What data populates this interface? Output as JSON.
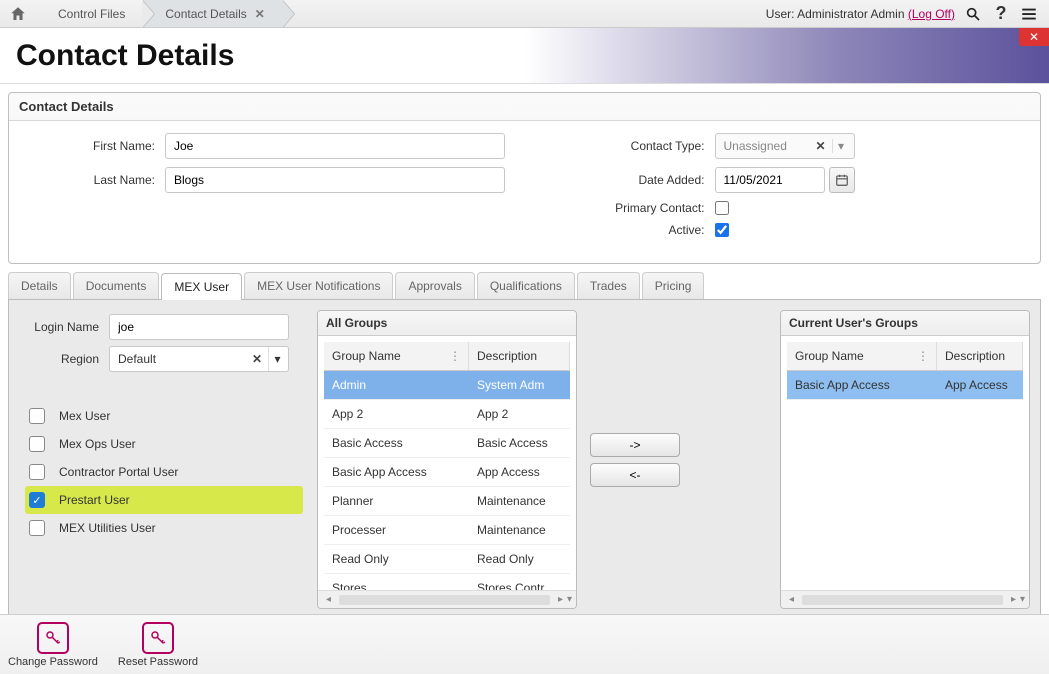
{
  "breadcrumb": {
    "item0": "Control Files",
    "item1": "Contact Details"
  },
  "userbar": {
    "prefix": "User: ",
    "name": "Administrator Admin",
    "logoff": "(Log Off)"
  },
  "page_title": "Contact Details",
  "panel": {
    "title": "Contact Details",
    "first_name_label": "First Name:",
    "first_name": "Joe",
    "last_name_label": "Last Name:",
    "last_name": "Blogs",
    "contact_type_label": "Contact Type:",
    "contact_type": "Unassigned",
    "date_added_label": "Date Added:",
    "date_added": "11/05/2021",
    "primary_label": "Primary Contact:",
    "active_label": "Active:"
  },
  "tabs": {
    "t0": "Details",
    "t1": "Documents",
    "t2": "MEX User",
    "t3": "MEX User Notifications",
    "t4": "Approvals",
    "t5": "Qualifications",
    "t6": "Trades",
    "t7": "Pricing"
  },
  "mex": {
    "login_label": "Login Name",
    "login": "joe",
    "region_label": "Region",
    "region": "Default",
    "checks": {
      "c0": "Mex User",
      "c1": "Mex Ops User",
      "c2": "Contractor Portal User",
      "c3": "Prestart User",
      "c4": "MEX Utilities User"
    }
  },
  "all_groups": {
    "title": "All Groups",
    "col_name": "Group Name",
    "col_desc": "Description",
    "rows": [
      {
        "name": "Admin",
        "desc": "System Adm"
      },
      {
        "name": "App 2",
        "desc": "App 2"
      },
      {
        "name": "Basic Access",
        "desc": "Basic Access"
      },
      {
        "name": "Basic App Access",
        "desc": "App Access"
      },
      {
        "name": "Planner",
        "desc": "Maintenance"
      },
      {
        "name": "Processer",
        "desc": "Maintenance"
      },
      {
        "name": "Read Only",
        "desc": "Read Only"
      },
      {
        "name": "Stores",
        "desc": "Stores Contr"
      }
    ]
  },
  "transfer": {
    "right": "->",
    "left": "<-"
  },
  "current_groups": {
    "title": "Current User's Groups",
    "col_name": "Group Name",
    "col_desc": "Description",
    "rows": [
      {
        "name": "Basic App Access",
        "desc": "App Access"
      }
    ]
  },
  "bottom": {
    "change": "Change Password",
    "reset": "Reset Password"
  }
}
